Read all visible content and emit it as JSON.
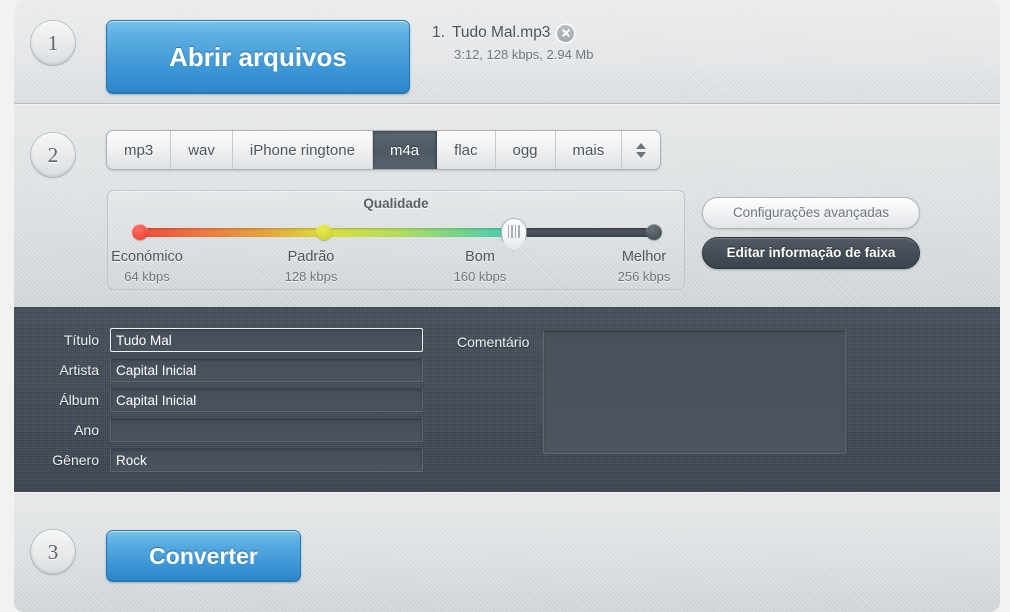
{
  "steps": {
    "one": "1",
    "two": "2",
    "three": "3"
  },
  "step1": {
    "open_files_label": "Abrir arquivos",
    "files": [
      {
        "index": "1.",
        "name": "Tudo Mal.mp3",
        "meta": "3:12, 128 kbps, 2.94 Mb",
        "remove_icon": "close-circle-icon"
      }
    ]
  },
  "step2": {
    "formats": [
      {
        "label": "mp3",
        "selected": false
      },
      {
        "label": "wav",
        "selected": false
      },
      {
        "label": "iPhone ringtone",
        "selected": false
      },
      {
        "label": "m4a",
        "selected": true
      },
      {
        "label": "flac",
        "selected": false
      },
      {
        "label": "ogg",
        "selected": false
      },
      {
        "label": "mais",
        "selected": false
      }
    ],
    "stepper_icon": "up-down-arrows-icon",
    "quality": {
      "title": "Qualidade",
      "selected_index": 2,
      "stops": [
        {
          "name": "Económico",
          "rate": "64 kbps"
        },
        {
          "name": "Padrão",
          "rate": "128 kbps"
        },
        {
          "name": "Bom",
          "rate": "160 kbps"
        },
        {
          "name": "Melhor",
          "rate": "256 kbps"
        }
      ]
    },
    "advanced_settings_label": "Configurações avançadas",
    "edit_track_info_label": "Editar informação de faixa"
  },
  "tag_editor": {
    "fields": [
      {
        "label": "Título",
        "value": "Tudo Mal",
        "focused": true
      },
      {
        "label": "Artista",
        "value": "Capital Inicial",
        "focused": false
      },
      {
        "label": "Álbum",
        "value": "Capital Inicial",
        "focused": false
      },
      {
        "label": "Ano",
        "value": "",
        "focused": false
      },
      {
        "label": "Gênero",
        "value": "Rock",
        "focused": false
      }
    ],
    "comment_label": "Comentário",
    "comment_value": ""
  },
  "step3": {
    "convert_label": "Converter"
  },
  "colors": {
    "accent_blue": "#3f98d6",
    "panel_light": "#dcdfe1",
    "panel_dark": "#434c58",
    "quality_low": "#ef4a3d",
    "quality_mid": "#dbdf3a",
    "quality_high": "#3ec8b5",
    "track_rest": "#454d54"
  }
}
